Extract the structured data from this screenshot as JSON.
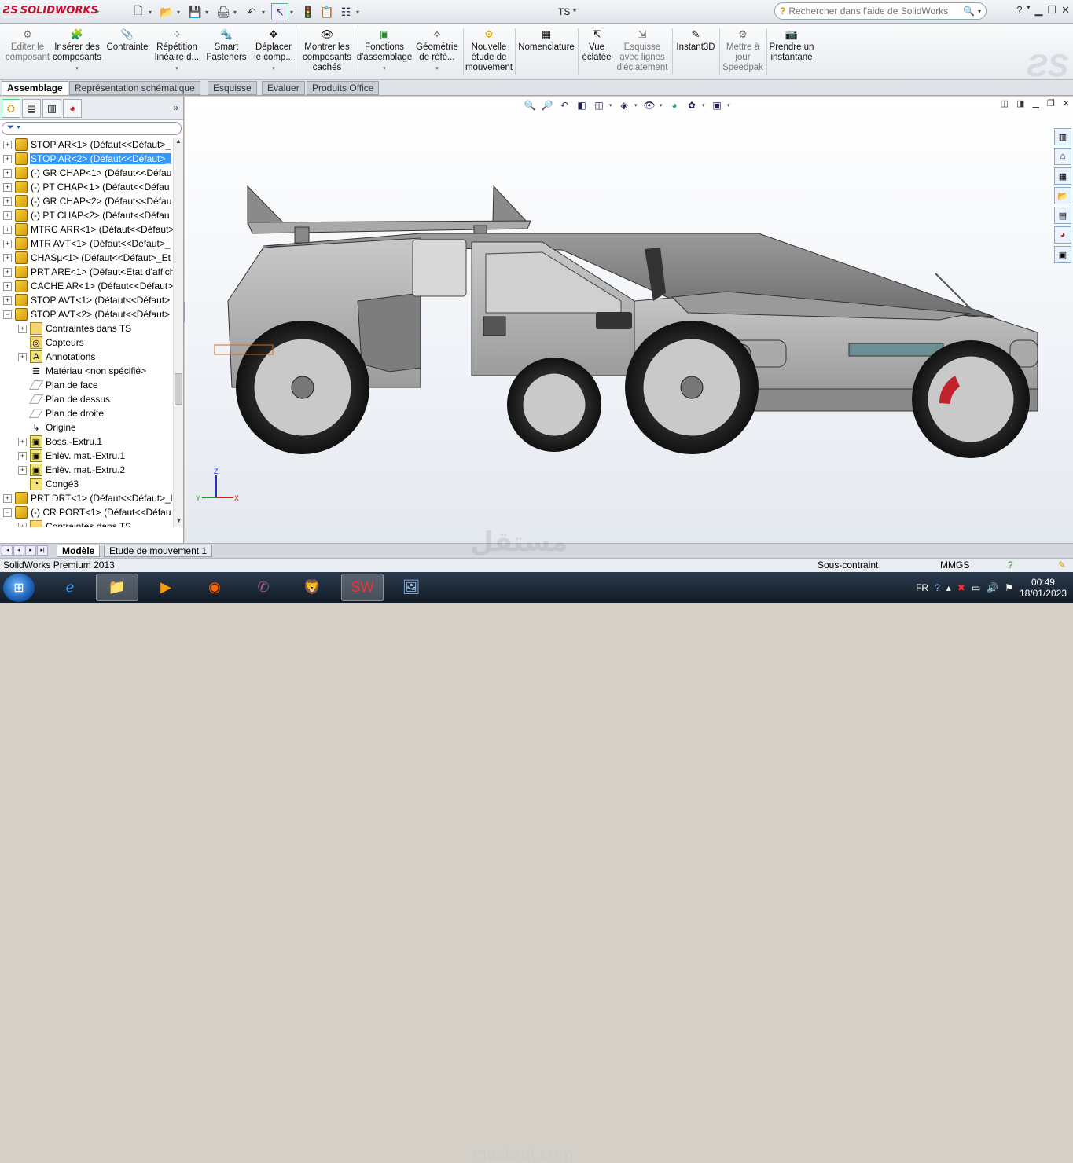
{
  "app": {
    "brand": "SOLIDWORKS",
    "document_title": "TS *"
  },
  "search": {
    "placeholder": "Rechercher dans l'aide de SolidWorks"
  },
  "ribbon": {
    "buttons": [
      {
        "label": "Editer le composant",
        "disabled": true
      },
      {
        "label": "Insérer des composants"
      },
      {
        "label": "Contrainte"
      },
      {
        "label": "Répétition linéaire d..."
      },
      {
        "label": "Smart Fasteners"
      },
      {
        "label": "Déplacer le comp..."
      },
      {
        "label": "Montrer les composants cachés"
      },
      {
        "label": "Fonctions d'assemblage"
      },
      {
        "label": "Géométrie de réfé..."
      },
      {
        "label": "Nouvelle étude de mouvement"
      },
      {
        "label": "Nomenclature"
      },
      {
        "label": "Vue éclatée"
      },
      {
        "label": "Esquisse avec lignes d'éclatement",
        "disabled": true
      },
      {
        "label": "Instant3D"
      },
      {
        "label": "Mettre à jour Speedpak",
        "disabled": true
      },
      {
        "label": "Prendre un instantané"
      }
    ]
  },
  "command_tabs": [
    "Assemblage",
    "Représentation schématique",
    "Esquisse",
    "Evaluer",
    "Produits Office"
  ],
  "tree": {
    "items": [
      {
        "label": "STOP AR<1> (Défaut<<Défaut>_",
        "icon": "part-icon",
        "expand": "+"
      },
      {
        "label": "STOP AR<2> (Défaut<<Défaut>_",
        "icon": "part-icon",
        "expand": "+",
        "selected": true
      },
      {
        "label": "(-) GR CHAP<1> (Défaut<<Défau",
        "icon": "part-icon",
        "expand": "+"
      },
      {
        "label": "(-) PT  CHAP<1> (Défaut<<Défau",
        "icon": "part-icon",
        "expand": "+"
      },
      {
        "label": "(-) GR CHAP<2> (Défaut<<Défau",
        "icon": "part-icon",
        "expand": "+"
      },
      {
        "label": "(-) PT  CHAP<2> (Défaut<<Défau",
        "icon": "part-icon",
        "expand": "+"
      },
      {
        "label": "MTRC ARR<1> (Défaut<<Défaut>",
        "icon": "part-icon",
        "expand": "+"
      },
      {
        "label": "MTR AVT<1> (Défaut<<Défaut>_",
        "icon": "part-icon",
        "expand": "+"
      },
      {
        "label": "CHASµ<1> (Défaut<<Défaut>_Et",
        "icon": "part-icon",
        "expand": "+"
      },
      {
        "label": "PRT ARE<1> (Défaut<Etat d'affich",
        "icon": "part-icon",
        "expand": "+"
      },
      {
        "label": "CACHE AR<1> (Défaut<<Défaut>",
        "icon": "part-icon",
        "expand": "+"
      },
      {
        "label": "STOP AVT<1> (Défaut<<Défaut>",
        "icon": "part-icon",
        "expand": "+"
      },
      {
        "label": "STOP AVT<2> (Défaut<<Défaut>",
        "icon": "part-icon",
        "expand": "−"
      },
      {
        "label": "Contraintes dans TS",
        "icon": "folder-icon",
        "expand": "+",
        "indent": 1
      },
      {
        "label": "Capteurs",
        "icon": "sensor-icon",
        "expand": "",
        "indent": 1
      },
      {
        "label": "Annotations",
        "icon": "annotation-icon",
        "expand": "+",
        "indent": 1
      },
      {
        "label": "Matériau <non spécifié>",
        "icon": "material-icon",
        "expand": "",
        "indent": 1
      },
      {
        "label": "Plan de face",
        "icon": "plane-icon",
        "expand": "",
        "indent": 1
      },
      {
        "label": "Plan de dessus",
        "icon": "plane-icon",
        "expand": "",
        "indent": 1
      },
      {
        "label": "Plan de droite",
        "icon": "plane-icon",
        "expand": "",
        "indent": 1
      },
      {
        "label": "Origine",
        "icon": "origin-icon",
        "expand": "",
        "indent": 1
      },
      {
        "label": "Boss.-Extru.1",
        "icon": "feature-icon",
        "expand": "+",
        "indent": 1
      },
      {
        "label": "Enlèv. mat.-Extru.1",
        "icon": "feature-icon",
        "expand": "+",
        "indent": 1
      },
      {
        "label": "Enlèv. mat.-Extru.2",
        "icon": "feature-icon",
        "expand": "+",
        "indent": 1
      },
      {
        "label": "Congé3",
        "icon": "fillet-icon",
        "expand": "",
        "indent": 1
      },
      {
        "label": "PRT DRT<1> (Défaut<<Défaut>_l",
        "icon": "part-icon",
        "expand": "+"
      },
      {
        "label": "(-) CR PORT<1> (Défaut<<Défau",
        "icon": "part-icon",
        "expand": "−"
      },
      {
        "label": "Contraintes dans TS",
        "icon": "folder-icon",
        "expand": "+",
        "indent": 1
      }
    ]
  },
  "triad": {
    "x": "X",
    "y": "Y",
    "z": "Z"
  },
  "bottom_tabs": [
    "Modèle",
    "Etude de mouvement 1"
  ],
  "status": {
    "product": "SolidWorks Premium 2013",
    "state": "Sous-contraint",
    "units": "MMGS"
  },
  "taskbar": {
    "lang": "FR",
    "time": "00:49",
    "date": "18/01/2023"
  },
  "watermark": {
    "arabic": "مستقل",
    "latin": "mostaql.com"
  },
  "colors": {
    "selection": "#3399ff",
    "brand": "#c8102e"
  }
}
